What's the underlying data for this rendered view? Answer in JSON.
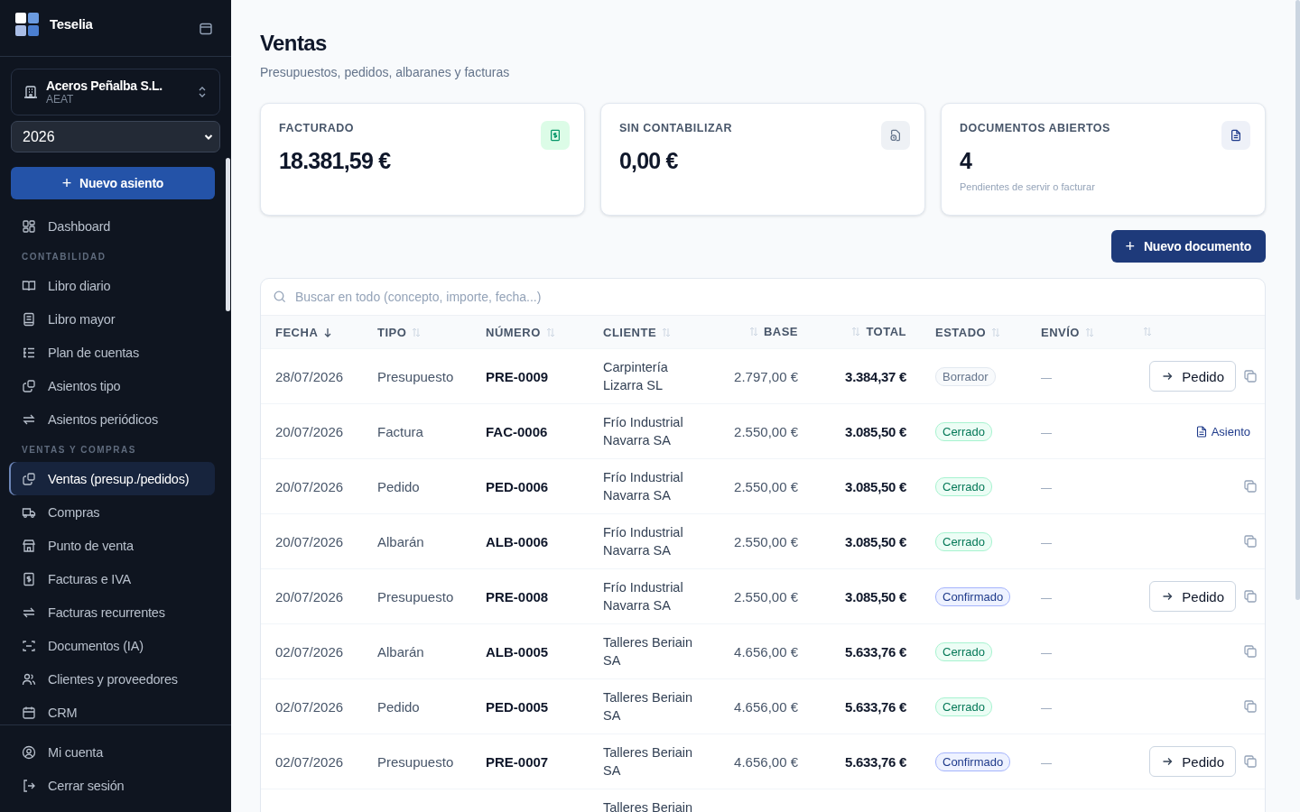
{
  "sidebar": {
    "brand": "Teselia",
    "company": {
      "name": "Aceros Peñalba S.L.",
      "subtitle": "AEAT"
    },
    "year": "2026",
    "primary_button": {
      "icon": "+",
      "label": "Nuevo asiento"
    },
    "nav": [
      {
        "kind": "item",
        "label": "Dashboard",
        "selected": false
      },
      {
        "kind": "section",
        "label": "CONTABILIDAD"
      },
      {
        "kind": "item",
        "label": "Libro diario",
        "selected": false
      },
      {
        "kind": "item",
        "label": "Libro mayor",
        "selected": false
      },
      {
        "kind": "item",
        "label": "Plan de cuentas",
        "selected": false
      },
      {
        "kind": "item",
        "label": "Asientos tipo",
        "selected": false
      },
      {
        "kind": "item",
        "label": "Asientos periódicos",
        "selected": false
      },
      {
        "kind": "section",
        "label": "VENTAS Y COMPRAS"
      },
      {
        "kind": "item",
        "label": "Ventas (presup./pedidos)",
        "selected": true
      },
      {
        "kind": "item",
        "label": "Compras",
        "selected": false
      },
      {
        "kind": "item",
        "label": "Punto de venta",
        "selected": false
      },
      {
        "kind": "item",
        "label": "Facturas e IVA",
        "selected": false
      },
      {
        "kind": "item",
        "label": "Facturas recurrentes",
        "selected": false
      },
      {
        "kind": "item",
        "label": "Documentos (IA)",
        "selected": false
      },
      {
        "kind": "item",
        "label": "Clientes y proveedores",
        "selected": false
      },
      {
        "kind": "item",
        "label": "CRM",
        "selected": false
      }
    ],
    "footer": [
      {
        "label": "Mi cuenta"
      },
      {
        "label": "Cerrar sesión"
      }
    ]
  },
  "page": {
    "title": "Ventas",
    "subtitle": "Presupuestos, pedidos, albaranes y facturas"
  },
  "cards": [
    {
      "kind": "invoiced",
      "label": "FACTURADO",
      "value": "18.381,59 €"
    },
    {
      "kind": "pending",
      "label": "SIN CONTABILIZAR",
      "value": "0,00 €"
    },
    {
      "kind": "open",
      "label": "DOCUMENTOS ABIERTOS",
      "value": "4",
      "note": "Pendientes de servir o facturar"
    }
  ],
  "new_button": {
    "icon": "+",
    "label": "Nuevo documento"
  },
  "search": {
    "placeholder": "Buscar en todo (concepto, importe, fecha...)"
  },
  "table": {
    "columns": [
      {
        "label": "FECHA",
        "sorted": true,
        "kind": "text"
      },
      {
        "label": "TIPO",
        "sorted": false,
        "kind": "text"
      },
      {
        "label": "NÚMERO",
        "sorted": false,
        "kind": "text"
      },
      {
        "label": "CLIENTE",
        "sorted": false,
        "kind": "text"
      },
      {
        "label": "BASE",
        "sorted": false,
        "kind": "amount"
      },
      {
        "label": "TOTAL",
        "sorted": false,
        "kind": "amount"
      },
      {
        "label": "ESTADO",
        "sorted": false,
        "kind": "text"
      },
      {
        "label": "ENVÍO",
        "sorted": false,
        "kind": "text"
      },
      {
        "sorted": false,
        "kind": "text"
      }
    ],
    "rows": [
      {
        "fecha": "28/07/2026",
        "tipo": "Presupuesto",
        "numero": "PRE-0009",
        "cliente": "Carpintería Lizarra SL",
        "base": "2.797,00 €",
        "total": "3.384,37 €",
        "estado": {
          "label": "Borrador",
          "kind": "draft"
        },
        "envio": "—",
        "actions": [
          {
            "kind": "convert",
            "label": "Pedido"
          },
          {
            "kind": "copy"
          }
        ]
      },
      {
        "fecha": "20/07/2026",
        "tipo": "Factura",
        "numero": "FAC-0006",
        "cliente": "Frío Industrial Navarra SA",
        "base": "2.550,00 €",
        "total": "3.085,50 €",
        "estado": {
          "label": "Cerrado",
          "kind": "closed"
        },
        "envio": "—",
        "actions": [
          {
            "kind": "journal",
            "label": "Asiento"
          }
        ]
      },
      {
        "fecha": "20/07/2026",
        "tipo": "Pedido",
        "numero": "PED-0006",
        "cliente": "Frío Industrial Navarra SA",
        "base": "2.550,00 €",
        "total": "3.085,50 €",
        "estado": {
          "label": "Cerrado",
          "kind": "closed"
        },
        "envio": "—",
        "actions": [
          {
            "kind": "copy"
          }
        ]
      },
      {
        "fecha": "20/07/2026",
        "tipo": "Albarán",
        "numero": "ALB-0006",
        "cliente": "Frío Industrial Navarra SA",
        "base": "2.550,00 €",
        "total": "3.085,50 €",
        "estado": {
          "label": "Cerrado",
          "kind": "closed"
        },
        "envio": "—",
        "actions": [
          {
            "kind": "copy"
          }
        ]
      },
      {
        "fecha": "20/07/2026",
        "tipo": "Presupuesto",
        "numero": "PRE-0008",
        "cliente": "Frío Industrial Navarra SA",
        "base": "2.550,00 €",
        "total": "3.085,50 €",
        "estado": {
          "label": "Confirmado",
          "kind": "confirmed"
        },
        "envio": "—",
        "actions": [
          {
            "kind": "convert",
            "label": "Pedido"
          },
          {
            "kind": "copy"
          }
        ]
      },
      {
        "fecha": "02/07/2026",
        "tipo": "Albarán",
        "numero": "ALB-0005",
        "cliente": "Talleres Beriain SA",
        "base": "4.656,00 €",
        "total": "5.633,76 €",
        "estado": {
          "label": "Cerrado",
          "kind": "closed"
        },
        "envio": "—",
        "actions": [
          {
            "kind": "copy"
          }
        ]
      },
      {
        "fecha": "02/07/2026",
        "tipo": "Pedido",
        "numero": "PED-0005",
        "cliente": "Talleres Beriain SA",
        "base": "4.656,00 €",
        "total": "5.633,76 €",
        "estado": {
          "label": "Cerrado",
          "kind": "closed"
        },
        "envio": "—",
        "actions": [
          {
            "kind": "copy"
          }
        ]
      },
      {
        "fecha": "02/07/2026",
        "tipo": "Presupuesto",
        "numero": "PRE-0007",
        "cliente": "Talleres Beriain SA",
        "base": "4.656,00 €",
        "total": "5.633,76 €",
        "estado": {
          "label": "Confirmado",
          "kind": "confirmed"
        },
        "envio": "—",
        "actions": [
          {
            "kind": "convert",
            "label": "Pedido"
          },
          {
            "kind": "copy"
          }
        ]
      },
      {
        "cliente": "Talleres Beriain"
      }
    ]
  }
}
